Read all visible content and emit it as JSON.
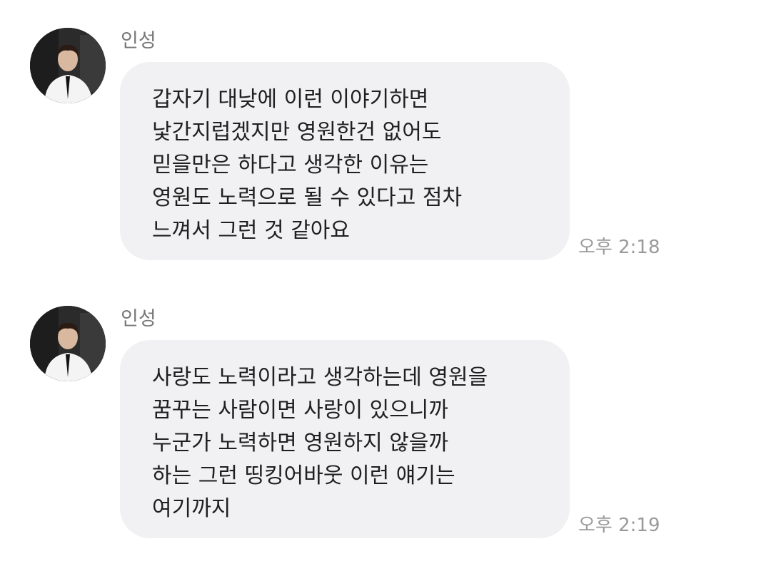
{
  "messages": [
    {
      "sender": "인성",
      "avatar_icon": "profile-photo",
      "lines": [
        "갑자기 대낮에 이런 이야기하면",
        "낯간지럽겠지만 영원한건 없어도",
        "믿을만은 하다고 생각한 이유는",
        "영원도 노력으로 될 수 있다고 점차",
        "느껴서 그런 것 같아요"
      ],
      "time": "오후 2:18"
    },
    {
      "sender": "인성",
      "avatar_icon": "profile-photo",
      "lines": [
        "사랑도 노력이라고 생각하는데 영원을",
        "꿈꾸는 사람이면 사랑이 있으니까",
        "누군가 노력하면 영원하지 않을까",
        "하는 그런 띵킹어바웃 이런 얘기는",
        "여기까지"
      ],
      "time": "오후 2:19"
    }
  ],
  "colors": {
    "bubble_bg": "#f1f1f3",
    "text": "#1f1f1f",
    "sender_text": "#777777",
    "time_text": "#9a9a9a"
  }
}
